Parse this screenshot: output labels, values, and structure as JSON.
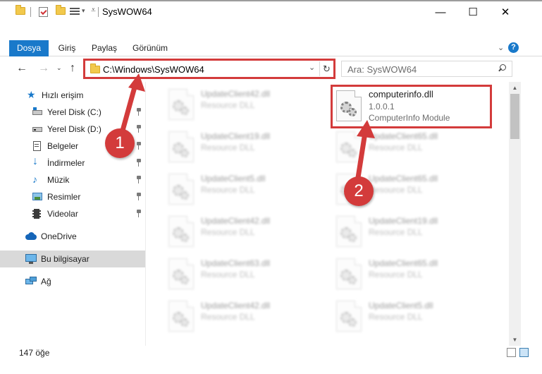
{
  "window": {
    "title": "SysWOW64",
    "minimize": "—",
    "maximize": "☐",
    "close": "✕"
  },
  "ribbon": {
    "tabs": [
      "Dosya",
      "Giriş",
      "Paylaş",
      "Görünüm"
    ],
    "help": "?"
  },
  "nav": {
    "address": "C:\\Windows\\SysWOW64",
    "search_placeholder": "Ara: SysWOW64"
  },
  "sidebar": {
    "items": [
      {
        "label": "Hızlı erişim",
        "icon": "star-icon"
      },
      {
        "label": "Yerel Disk (C:)",
        "icon": "drive-icon",
        "pinned": true
      },
      {
        "label": "Yerel Disk (D:)",
        "icon": "drive-icon",
        "pinned": true
      },
      {
        "label": "Belgeler",
        "icon": "documents-icon",
        "pinned": true
      },
      {
        "label": "İndirmeler",
        "icon": "downloads-icon",
        "pinned": true
      },
      {
        "label": "Müzik",
        "icon": "music-icon",
        "pinned": true
      },
      {
        "label": "Resimler",
        "icon": "pictures-icon",
        "pinned": true
      },
      {
        "label": "Videolar",
        "icon": "videos-icon",
        "pinned": true
      },
      {
        "label": "OneDrive",
        "icon": "cloud-icon"
      },
      {
        "label": "Bu bilgisayar",
        "icon": "computer-icon",
        "selected": true
      },
      {
        "label": "Ağ",
        "icon": "network-icon"
      }
    ]
  },
  "files": {
    "left": [
      {
        "name": "UpdateClient42.dll",
        "desc": "Resource DLL"
      },
      {
        "name": "UpdateClient19.dll",
        "desc": "Resource DLL"
      },
      {
        "name": "UpdateClient5.dll",
        "desc": "Resource DLL"
      },
      {
        "name": "UpdateClient42.dll",
        "desc": "Resource DLL"
      },
      {
        "name": "UpdateClient63.dll",
        "desc": "Resource DLL"
      },
      {
        "name": "UpdateClient42.dll",
        "desc": "Resource DLL"
      }
    ],
    "right": [
      {
        "name": "computerinfo.dll",
        "version": "1.0.0.1",
        "desc": "ComputerInfo Module",
        "highlighted": true
      },
      {
        "name": "UpdateClient65.dll",
        "desc": "Resource DLL"
      },
      {
        "name": "UpdateClient65.dll",
        "desc": "Resource DLL"
      },
      {
        "name": "UpdateClient19.dll",
        "desc": "Resource DLL"
      },
      {
        "name": "UpdateClient65.dll",
        "desc": "Resource DLL"
      },
      {
        "name": "UpdateClient5.dll",
        "desc": "Resource DLL"
      }
    ]
  },
  "status": {
    "item_count": "147 öğe"
  },
  "annotations": {
    "badge1": "1",
    "badge2": "2",
    "highlight_color": "#d33b3b"
  },
  "colors": {
    "accent": "#1979ca",
    "folder": "#f2c94c"
  }
}
